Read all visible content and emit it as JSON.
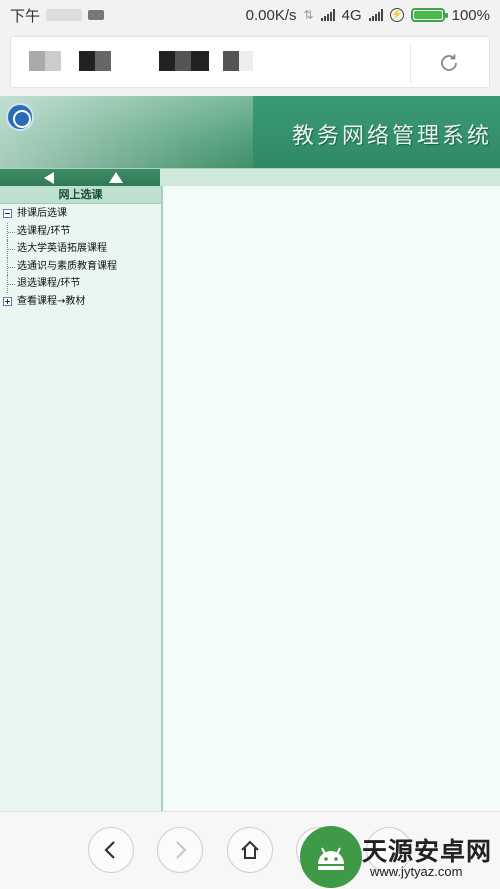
{
  "status_bar": {
    "time": "下午",
    "network_speed": "0.00K/s",
    "network_type": "4G",
    "battery": "100%",
    "battery_level": 1.0
  },
  "site": {
    "header_title": "教务网络管理系统",
    "panel_title": "网上选课"
  },
  "tree": {
    "groups": [
      {
        "label": "排课后选课",
        "expanded": true,
        "items": [
          {
            "label": "选课程/环节"
          },
          {
            "label": "选大学英语拓展课程"
          },
          {
            "label": "选通识与素质教育课程"
          },
          {
            "label": "退选课程/环节"
          }
        ]
      },
      {
        "label": "查看课程→教材",
        "expanded": false,
        "items": []
      }
    ]
  },
  "watermark": {
    "name": "天源安卓网",
    "url": "www.jytyaz.com"
  },
  "colors": {
    "header_green": "#3f8d68",
    "panel_bg": "#eaf6f1",
    "battery_green": "#4cb84a",
    "watermark_green": "#3f9a48"
  }
}
